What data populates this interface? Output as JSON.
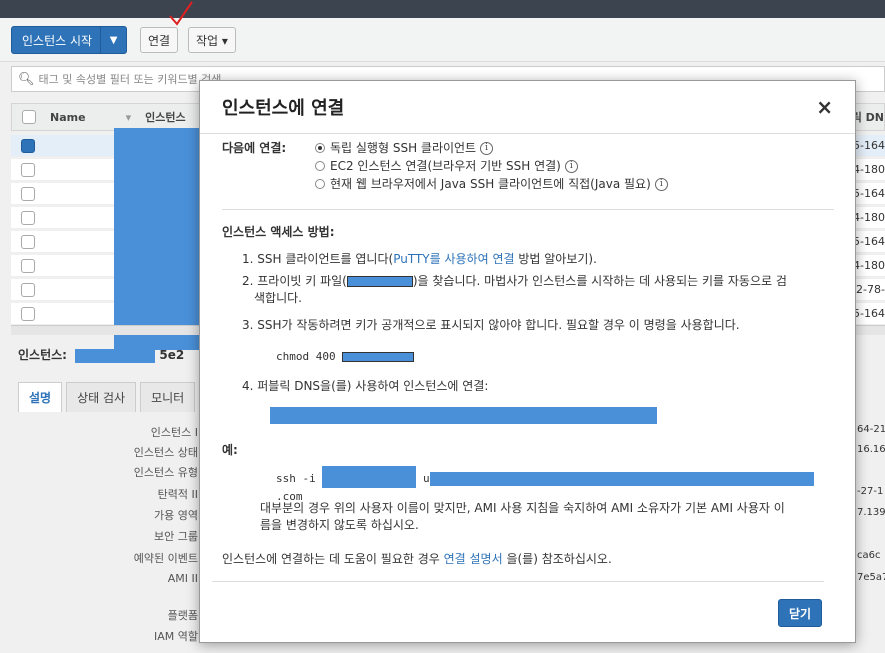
{
  "toolbar": {
    "launch_label": "인스턴스 시작",
    "launch_caret": "▼",
    "connect_label": "연결",
    "actions_label": "작업 ▾"
  },
  "search": {
    "placeholder": "태그 및 속성별 필터 또는 키워드별 검색"
  },
  "table": {
    "col_name": "Name",
    "col_instance": "인스턴스",
    "col_dns_fragment": "릭 DN",
    "rows_dns": [
      "5-164",
      "4-180",
      "5-164",
      "4-180",
      "5-164",
      "4-180",
      "52-78-",
      "5-164"
    ]
  },
  "instance_bar": {
    "label": "인스턴스:",
    "suffix": "5e2"
  },
  "detail_tabs": [
    "설명",
    "상태 검사",
    "모니터"
  ],
  "detail_labels": [
    "인스턴스 I",
    "인스턴스 상태",
    "인스턴스 유형",
    "탄력적 II",
    "가용 영역",
    "보안 그룹",
    "예약된 이벤트",
    "AMI II",
    "플랫폼",
    "IAM 역할"
  ],
  "detail_right_frags": [
    "64-21",
    "16.16",
    "-27-1",
    "7.139",
    "ca6c",
    "7e5a7"
  ],
  "modal": {
    "title": "인스턴스에 연결",
    "close_glyph": "×",
    "connect_with_label": "다음에 연결:",
    "options": [
      "독립 실행형 SSH 클라이언트",
      "EC2 인스턴스 연결(브라우저 기반 SSH 연결)",
      "현재 웹 브라우저에서 Java SSH 클라이언트에 직접(Java 필요)"
    ],
    "info_glyph": "i",
    "access_title": "인스턴스 액세스 방법:",
    "step1_prefix": "1. SSH 클라이언트를 엽니다(",
    "step1_link": "PuTTY를 사용하여 연결",
    "step1_suffix": " 방법 알아보기).",
    "step2_prefix": "2. 프라이빗 키 파일(",
    "step2_suffix": ")을 찾습니다. 마법사가 인스턴스를 시작하는 데 사용되는 키를 자동으로 검",
    "step2_line2": "색합니다.",
    "step3": "3. SSH가 작동하려면 키가 공개적으로 표시되지 않아야 합니다. 필요할 경우 이 명령을 사용합니다.",
    "chmod_cmd": "chmod 400 ",
    "step4": "4. 퍼블릭 DNS을(를) 사용하여 인스턴스에 연결:",
    "example_label": "예:",
    "ssh_prefix": "ssh -i ",
    "ssh_user_char": "u",
    "ssh_suffix": ".com",
    "note_line1": "대부분의 경우 위의 사용자 이름이 맞지만, AMI 사용 지침을 숙지하여 AMI 소유자가 기본 AMI 사용자 이",
    "note_line2": "름을 변경하지 않도록 하십시오.",
    "help_prefix": "인스턴스에 연결하는 데 도움이 필요한 경우 ",
    "help_link": "연결 설명서",
    "help_suffix": " 을(를) 참조하십시오.",
    "close_button": "닫기"
  },
  "colors": {
    "accent": "#2e73b8",
    "redaction": "#4a90d9",
    "checkmark": "#e02020"
  }
}
